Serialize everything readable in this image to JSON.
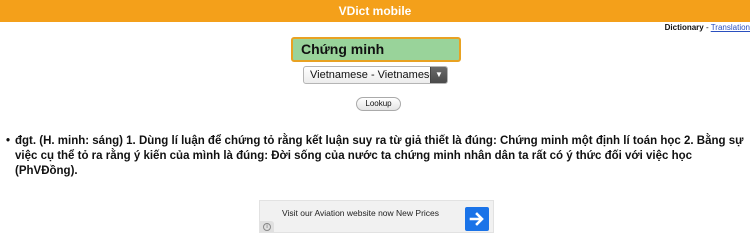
{
  "header": {
    "title": "VDict mobile"
  },
  "toplinks": {
    "dictionary": "Dictionary",
    "separator": " - ",
    "translation": "Translation"
  },
  "search": {
    "value": "Chứng minh"
  },
  "language_select": {
    "selected": "Vietnamese - Vietnamese"
  },
  "lookup": {
    "label": "Lookup"
  },
  "definition": {
    "bullet": "•",
    "text": "đgt. (H. minh: sáng) 1. Dùng lí luận để chứng tỏ rằng kết luận suy ra từ giả thiết là đúng: Chứng minh một định lí toán học 2. Bằng sự việc cụ thể tỏ ra rằng ý kiến của mình là đúng: Đời sống của nước ta chứng minh nhân dân ta rất có ý thức đối với việc học (PhVĐồng)."
  },
  "ad": {
    "text": "Visit our Aviation website now New Prices"
  },
  "colors": {
    "header_bg": "#f4a01a",
    "input_bg": "#99d39a",
    "input_border": "#e8a222",
    "ad_button": "#1a73e8",
    "link": "#2a4fbf"
  }
}
